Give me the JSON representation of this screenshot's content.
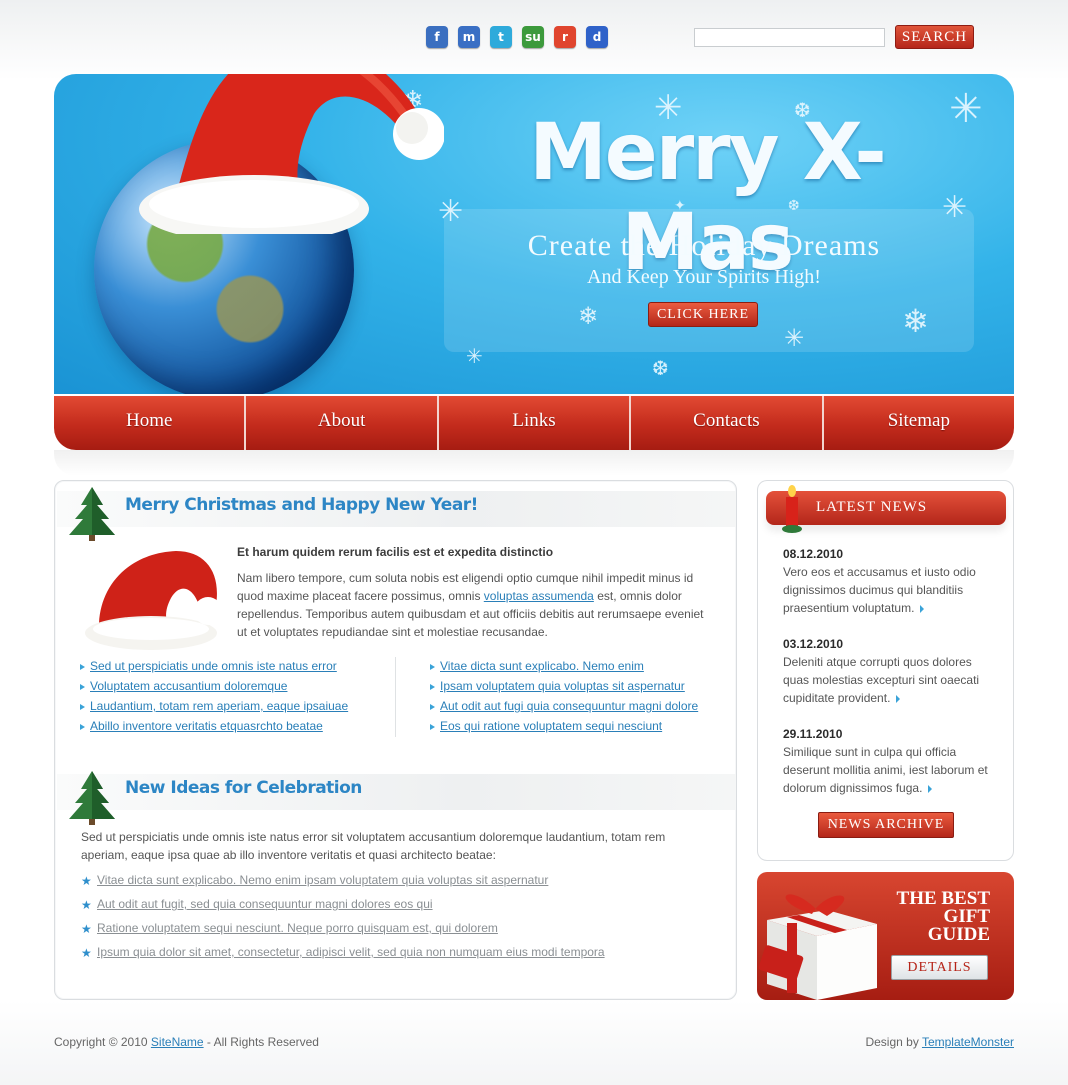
{
  "social": [
    {
      "icon": "facebook-icon",
      "glyph": "f",
      "color": "#3b6fc0"
    },
    {
      "icon": "myspace-icon",
      "glyph": "m",
      "color": "#3a6fc4"
    },
    {
      "icon": "twitter-icon",
      "glyph": "t",
      "color": "#2eaadb"
    },
    {
      "icon": "stumbleupon-icon",
      "glyph": "su",
      "color": "#3c9a3c"
    },
    {
      "icon": "reddit-icon",
      "glyph": "r",
      "color": "#e0452e"
    },
    {
      "icon": "delicious-icon",
      "glyph": "d",
      "color": "#2f62c9"
    }
  ],
  "search": {
    "value": "",
    "button_label": "SEARCH"
  },
  "banner": {
    "title": "Merry X-Mas",
    "subtitle": "Create the Holiday Dreams",
    "tagline": "And Keep Your Spirits High!",
    "button_label": "CLICK HERE"
  },
  "nav": [
    {
      "label": "Home"
    },
    {
      "label": "About"
    },
    {
      "label": "Links"
    },
    {
      "label": "Contacts"
    },
    {
      "label": "Sitemap"
    }
  ],
  "main": {
    "section1_title": "Merry Christmas and Happy New Year!",
    "intro_heading": "Et harum quidem rerum facilis est et expedita distinctio",
    "intro_text_before": "Nam libero tempore, cum soluta nobis est eligendi optio cumque nihil impedit minus id quod maxime placeat facere possimus, omnis ",
    "intro_link": "voluptas assumenda",
    "intro_text_after": " est, omnis dolor repellendus. Temporibus autem quibusdam et aut officiis debitis aut rerumsaepe eveniet ut et voluptates repudiandae sint et molestiae recusandae.",
    "links_left": [
      "Sed ut perspiciatis unde omnis iste natus error",
      "Voluptatem accusantium doloremque",
      "Laudantium, totam rem aperiam, eaque ipsaiuae",
      "Abillo inventore veritatis etquasrchto beatae"
    ],
    "links_right": [
      "Vitae dicta sunt explicabo. Nemo enim",
      "Ipsam voluptatem quia voluptas sit aspernatur",
      "Aut odit aut fugi quia consequuntur magni dolore",
      "Eos qui ratione voluptatem sequi nesciunt"
    ],
    "section2_title": "New Ideas for Celebration",
    "ideas_intro": "Sed ut perspiciatis unde omnis iste natus error sit voluptatem accusantium doloremque laudantium, totam rem aperiam, eaque ipsa quae ab illo inventore veritatis et quasi architecto beatae:",
    "ideas": [
      "Vitae dicta sunt explicabo. Nemo enim ipsam voluptatem quia voluptas sit aspernatur",
      "Aut odit aut fugit, sed quia consequuntur magni dolores eos qui",
      "Ratione voluptatem sequi nesciunt. Neque porro quisquam est, qui dolorem",
      "Ipsum quia dolor sit amet, consectetur, adipisci velit, sed quia non numquam eius modi tempora"
    ]
  },
  "news": {
    "title": "LATEST NEWS",
    "items": [
      {
        "date": "08.12.2010",
        "text": "Vero eos et accusamus et iusto odio dignissimos ducimus qui blanditiis praesentium voluptatum."
      },
      {
        "date": "03.12.2010",
        "text": "Deleniti atque corrupti quos dolores quas molestias excepturi sint oaecati cupiditate provident."
      },
      {
        "date": "29.11.2010",
        "text": "Similique sunt in culpa qui officia deserunt mollitia animi, iest laborum et dolorum dignissimos fuga."
      }
    ],
    "archive_label": "NEWS ARCHIVE"
  },
  "gift": {
    "line1": "THE BEST",
    "line2": "GIFT",
    "line3": "GUIDE",
    "button_label": "DETAILS"
  },
  "footer": {
    "copyright_prefix": "Copyright © 2010 ",
    "site_link": "SiteName",
    "copyright_suffix": " - All Rights Reserved",
    "design_prefix": "Design by ",
    "design_link": "TemplateMonster"
  }
}
